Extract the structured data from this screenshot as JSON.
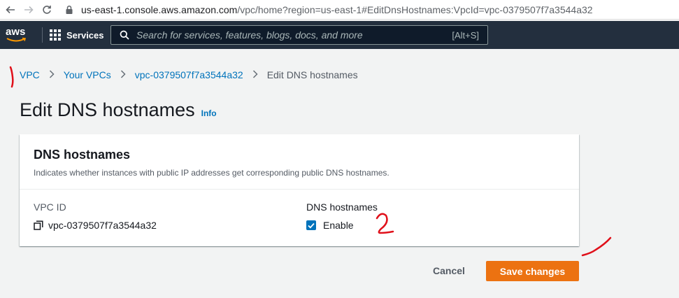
{
  "browser": {
    "url_host": "us-east-1.console.aws.amazon.com",
    "url_path": "/vpc/home?region=us-east-1#EditDnsHostnames:VpcId=vpc-0379507f7a3544a32"
  },
  "header": {
    "logo_text": "aws",
    "services_label": "Services",
    "search_placeholder": "Search for services, features, blogs, docs, and more",
    "search_shortcut": "[Alt+S]"
  },
  "breadcrumb": {
    "items": [
      "VPC",
      "Your VPCs",
      "vpc-0379507f7a3544a32"
    ],
    "current": "Edit DNS hostnames"
  },
  "page": {
    "title": "Edit DNS hostnames",
    "info_link": "Info"
  },
  "panel": {
    "title": "DNS hostnames",
    "description": "Indicates whether instances with public IP addresses get corresponding public DNS hostnames.",
    "vpc_id_label": "VPC ID",
    "vpc_id_value": "vpc-0379507f7a3544a32",
    "dns_label": "DNS hostnames",
    "enable_label": "Enable",
    "enable_checked": true
  },
  "actions": {
    "cancel_label": "Cancel",
    "save_label": "Save changes"
  },
  "colors": {
    "header_bg": "#232f3e",
    "link": "#0073bb",
    "primary_button": "#ec7211",
    "annotation": "#e0101a"
  },
  "annotations": [
    "1",
    "2"
  ]
}
